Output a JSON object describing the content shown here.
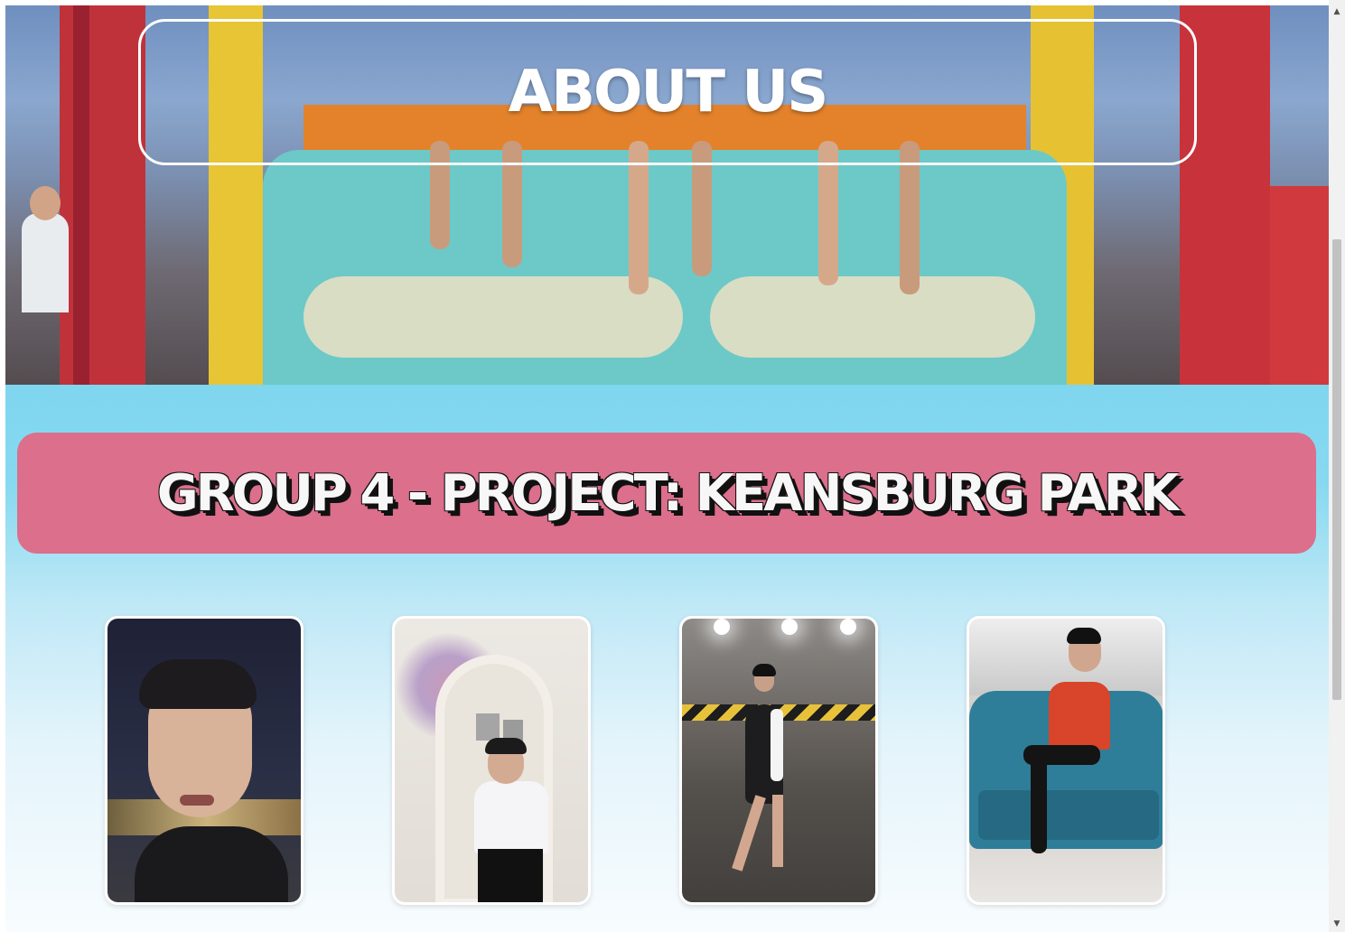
{
  "hero": {
    "title": "ABOUT US"
  },
  "group": {
    "title": "GROUP 4 - PROJECT: KEANSBURG PARK"
  },
  "members": [
    {
      "photo_icon": "member-photo"
    },
    {
      "photo_icon": "member-photo"
    },
    {
      "photo_icon": "member-photo"
    },
    {
      "photo_icon": "member-photo"
    }
  ],
  "scrollbar": {
    "up_icon": "▲",
    "down_icon": "▼"
  },
  "colors": {
    "banner": "#db6f8c",
    "section_top": "#7fd6ef",
    "hero_border": "#ffffff"
  }
}
